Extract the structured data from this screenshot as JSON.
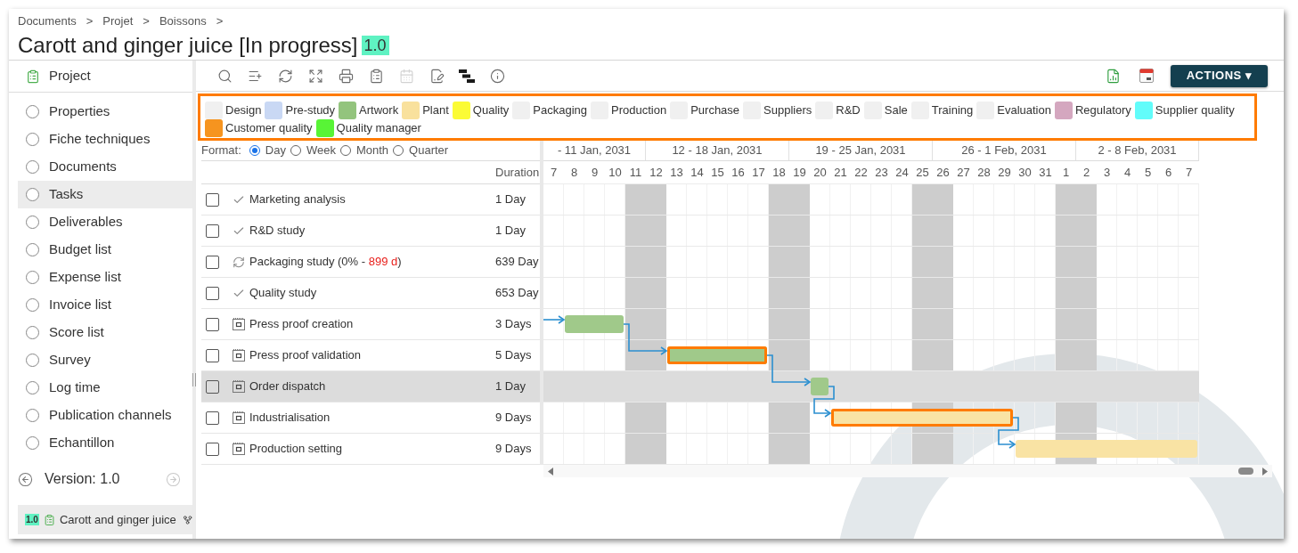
{
  "breadcrumb": [
    {
      "label": "Documents",
      "separator": ">"
    },
    {
      "label": "Projet",
      "separator": ">"
    },
    {
      "label": "Boissons",
      "separator": ">"
    }
  ],
  "title": "Carott and ginger juice [In progress]",
  "version_badge": "1.0",
  "sidebar": {
    "header": "Project",
    "items": [
      {
        "label": "Properties",
        "selected": false
      },
      {
        "label": "Fiche techniques",
        "selected": false
      },
      {
        "label": "Documents",
        "selected": false
      },
      {
        "label": "Tasks",
        "selected": true
      },
      {
        "label": "Deliverables",
        "selected": false
      },
      {
        "label": "Budget list",
        "selected": false
      },
      {
        "label": "Expense list",
        "selected": false
      },
      {
        "label": "Invoice list",
        "selected": false
      },
      {
        "label": "Score list",
        "selected": false
      },
      {
        "label": "Survey",
        "selected": false
      },
      {
        "label": "Log time",
        "selected": false
      },
      {
        "label": "Publication channels",
        "selected": false
      },
      {
        "label": "Echantillon",
        "selected": false
      }
    ],
    "version": {
      "label": "Version: 1.0",
      "previous": {
        "disabled": false
      },
      "next": {
        "disabled": true
      }
    },
    "current": {
      "badge": "1.0",
      "label": "Carott and ginger juice"
    }
  },
  "toolbar": {
    "tools": [
      {
        "disabled": false
      },
      {
        "disabled": false
      },
      {
        "disabled": false
      },
      {
        "disabled": false
      },
      {
        "disabled": false
      },
      {
        "disabled": false
      },
      {
        "disabled": true
      },
      {
        "disabled": false
      },
      {
        "disabled": false
      },
      {
        "disabled": false
      }
    ],
    "actions": "ACTIONS ▾"
  },
  "legend": [
    {
      "label": "Design",
      "color": "#f0f0f0"
    },
    {
      "label": "Pre-study",
      "color": "#c9d8f4"
    },
    {
      "label": "Artwork",
      "color": "#93c47d"
    },
    {
      "label": "Plant",
      "color": "#f9e19d"
    },
    {
      "label": "Quality",
      "color": "#fbfb35"
    },
    {
      "label": "Packaging",
      "color": "#f0f0f0"
    },
    {
      "label": "Production",
      "color": "#f0f0f0"
    },
    {
      "label": "Purchase",
      "color": "#f0f0f0"
    },
    {
      "label": "Suppliers",
      "color": "#f0f0f0"
    },
    {
      "label": "R&D",
      "color": "#f0f0f0"
    },
    {
      "label": "Sale",
      "color": "#f0f0f0"
    },
    {
      "label": "Training",
      "color": "#f0f0f0"
    },
    {
      "label": "Evaluation",
      "color": "#f0f0f0"
    },
    {
      "label": "Regulatory",
      "color": "#d4a7bf"
    },
    {
      "label": "Supplier quality",
      "color": "#62fcfa"
    },
    {
      "label": "Customer quality",
      "color": "#f6941f"
    },
    {
      "label": "Quality manager",
      "color": "#58f436"
    }
  ],
  "format": {
    "label": "Format:",
    "options": [
      {
        "label": "Day",
        "selected": true
      },
      {
        "label": "Week",
        "selected": false
      },
      {
        "label": "Month",
        "selected": false
      },
      {
        "label": "Quarter",
        "selected": false
      }
    ]
  },
  "table": {
    "columns": [
      "Duration"
    ],
    "rows": [
      {
        "checked": false,
        "selected": false,
        "kind": "done",
        "name": "Marketing analysis",
        "duration": "1 Day"
      },
      {
        "checked": false,
        "selected": false,
        "kind": "done",
        "name": "R&D study",
        "duration": "1 Day"
      },
      {
        "checked": false,
        "selected": false,
        "kind": "progress",
        "name": "Packaging study (0% -",
        "late": "899 d",
        "name_end": ")",
        "duration": "639 Day"
      },
      {
        "checked": false,
        "selected": false,
        "kind": "done",
        "name": "Quality study",
        "duration": "653 Day"
      },
      {
        "checked": false,
        "selected": false,
        "kind": "planned",
        "name": "Press proof creation",
        "duration": "3 Days",
        "bar": {
          "start": {
            "level": 0.03125
          },
          "color": "#a0c98a",
          "highlighted": false,
          "linked": true
        }
      },
      {
        "checked": false,
        "selected": false,
        "kind": "planned",
        "name": "Press proof validation",
        "duration": "5 Days",
        "bar": {
          "color": "#a0c98a",
          "highlighted": true,
          "linked": true
        }
      },
      {
        "checked": false,
        "selected": true,
        "kind": "planned",
        "name": "Order dispatch",
        "duration": "1 Day",
        "bar": {
          "color": "#a0c98a",
          "highlighted": false,
          "linked": true
        }
      },
      {
        "checked": false,
        "selected": false,
        "kind": "planned",
        "name": "Industrialisation",
        "duration": "9 Days",
        "bar": {
          "color": "#f9e3a4",
          "highlighted": true,
          "linked": true
        }
      },
      {
        "checked": false,
        "selected": false,
        "kind": "planned",
        "name": "Production setting",
        "duration": "9 Days",
        "bar": {
          "color": "#f9e3a4",
          "highlighted": false,
          "linked": true
        }
      }
    ]
  },
  "timeline": {
    "weeks": [
      "- 11 Jan, 2031",
      "12 - 18 Jan, 2031",
      "19 - 25 Jan, 2031",
      "26 - 1 Feb, 2031",
      "2 - 8 Feb, 2031"
    ],
    "days": [
      {
        "label": "7",
        "weekend": false
      },
      {
        "label": "8",
        "weekend": false
      },
      {
        "label": "9",
        "weekend": false
      },
      {
        "label": "10",
        "weekend": false
      },
      {
        "label": "11",
        "weekend": true
      },
      {
        "label": "12",
        "weekend": true
      },
      {
        "label": "13",
        "weekend": false
      },
      {
        "label": "14",
        "weekend": false
      },
      {
        "label": "15",
        "weekend": false
      },
      {
        "label": "16",
        "weekend": false
      },
      {
        "label": "17",
        "weekend": false
      },
      {
        "label": "18",
        "weekend": true
      },
      {
        "label": "19",
        "weekend": true
      },
      {
        "label": "20",
        "weekend": false
      },
      {
        "label": "21",
        "weekend": false
      },
      {
        "label": "22",
        "weekend": false
      },
      {
        "label": "23",
        "weekend": false
      },
      {
        "label": "24",
        "weekend": false
      },
      {
        "label": "25",
        "weekend": true
      },
      {
        "label": "26",
        "weekend": true
      },
      {
        "label": "27",
        "weekend": false
      },
      {
        "label": "28",
        "weekend": false
      },
      {
        "label": "29",
        "weekend": false
      },
      {
        "label": "30",
        "weekend": false
      },
      {
        "label": "31",
        "weekend": false
      },
      {
        "label": "1",
        "weekend": true
      },
      {
        "label": "2",
        "weekend": true
      },
      {
        "label": "3",
        "weekend": false
      },
      {
        "label": "4",
        "weekend": false
      },
      {
        "label": "5",
        "weekend": false
      },
      {
        "label": "6",
        "weekend": false
      },
      {
        "label": "7",
        "weekend": false
      }
    ]
  }
}
